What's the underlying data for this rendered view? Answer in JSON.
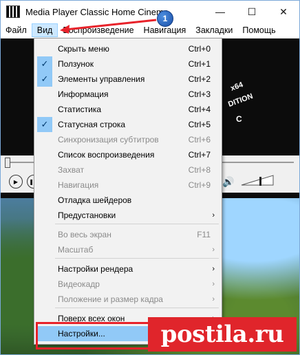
{
  "window": {
    "title": "Media Player Classic Home Cinema",
    "buttons": [
      "—",
      "☐",
      "✕"
    ]
  },
  "menubar": {
    "items": [
      "Файл",
      "Вид",
      "Воспроизведение",
      "Навигация",
      "Закладки",
      "Помощь"
    ],
    "active": "Вид"
  },
  "video": {
    "overlay_lines": [
      "x64",
      "DITION",
      "C"
    ]
  },
  "dropdown": {
    "items": [
      {
        "label": "Скрыть меню",
        "shortcut": "Ctrl+0",
        "checked": false,
        "disabled": false
      },
      {
        "label": "Ползунок",
        "shortcut": "Ctrl+1",
        "checked": true,
        "disabled": false
      },
      {
        "label": "Элементы управления",
        "shortcut": "Ctrl+2",
        "checked": true,
        "disabled": false
      },
      {
        "label": "Информация",
        "shortcut": "Ctrl+3",
        "checked": false,
        "disabled": false
      },
      {
        "label": "Статистика",
        "shortcut": "Ctrl+4",
        "checked": false,
        "disabled": false
      },
      {
        "label": "Статусная строка",
        "shortcut": "Ctrl+5",
        "checked": true,
        "disabled": false
      },
      {
        "label": "Синхронизация субтитров",
        "shortcut": "Ctrl+6",
        "checked": false,
        "disabled": true
      },
      {
        "label": "Список воспроизведения",
        "shortcut": "Ctrl+7",
        "checked": false,
        "disabled": false
      },
      {
        "label": "Захват",
        "shortcut": "Ctrl+8",
        "checked": false,
        "disabled": true
      },
      {
        "label": "Навигация",
        "shortcut": "Ctrl+9",
        "checked": false,
        "disabled": true
      },
      {
        "label": "Отладка шейдеров",
        "shortcut": "",
        "checked": false,
        "disabled": false
      },
      {
        "label": "Предустановки",
        "shortcut": "",
        "submenu": true,
        "disabled": false
      },
      {
        "label": "Во весь экран",
        "shortcut": "F11",
        "disabled": true
      },
      {
        "label": "Масштаб",
        "shortcut": "",
        "submenu": true,
        "disabled": true
      },
      {
        "label": "Настройки рендера",
        "shortcut": "",
        "submenu": true,
        "disabled": false
      },
      {
        "label": "Видеокадр",
        "shortcut": "",
        "submenu": true,
        "disabled": true
      },
      {
        "label": "Положение и размер кадра",
        "shortcut": "",
        "submenu": true,
        "disabled": true
      },
      {
        "label": "Поверх всех окон",
        "shortcut": "",
        "submenu": true,
        "disabled": false
      },
      {
        "label": "Настройки...",
        "shortcut": "",
        "highlighted": true,
        "disabled": false
      }
    ]
  },
  "annotations": {
    "badge_number": "1",
    "watermark_text": "postila.ru",
    "highlight_color": "#e8222a"
  }
}
